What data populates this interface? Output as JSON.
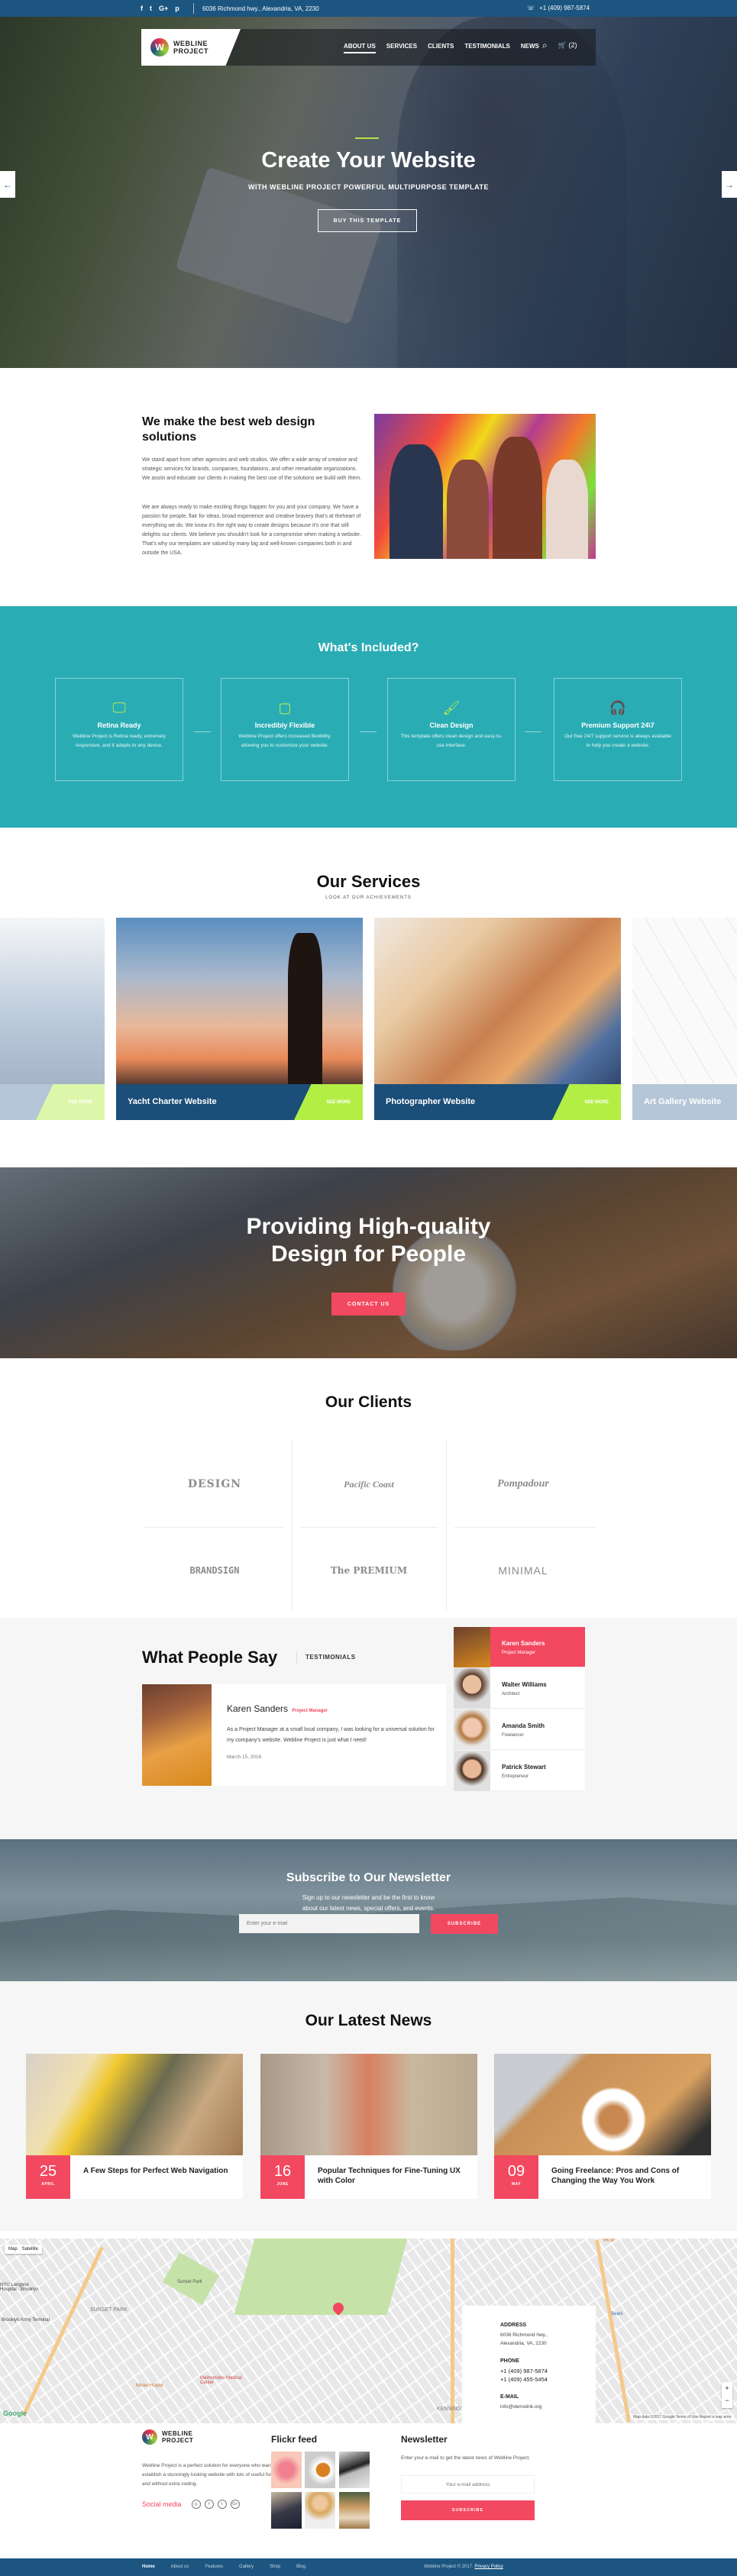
{
  "topbar": {
    "social_icons": [
      "f",
      "t",
      "G+",
      "p"
    ],
    "social_names": [
      "facebook-icon",
      "twitter-icon",
      "google-plus-icon",
      "pinterest-icon"
    ],
    "address": "6036 Richmond hwy., Alexandria, VA, 2230",
    "phone_icon": "☏",
    "phone": "+1 (409) 987-5874"
  },
  "brand": {
    "line1": "WEBLINE",
    "line2": "PROJECT",
    "mark": "W"
  },
  "nav": {
    "items": [
      "ABOUT US",
      "SERVICES",
      "CLIENTS",
      "TESTIMONIALS",
      "NEWS"
    ],
    "active_index": 0,
    "search_icon": "⌕",
    "cart_icon": "🛒",
    "cart_count": "(2)"
  },
  "hero": {
    "title": "Create Your Website",
    "subtitle": "WITH WEBLINE PROJECT POWERFUL MULTIPURPOSE TEMPLATE",
    "button": "BUY THIS TEMPLATE",
    "prev_icon": "←",
    "next_icon": "→"
  },
  "about": {
    "title": "We make the best web design solutions",
    "p1": "We stand apart from other agencies and web studios. We offer a wide array of creative and strategic services for brands, companies, foundations, and other remarkable organizations. We assist and educate our clients in making the best use of the solutions we build with them.",
    "p2": "We are always ready to make exciting things happen for you and your company. We have a passion for people, flair for ideas, broad experience and creative bravery that's at theheart of everything we do. We know it's the right way to create designs because it's one that still delights our clients. We believe you shouldn't look for a compromise when making a website. That's why our templates are valued by many big and well-known companies both in and outside the USA."
  },
  "included": {
    "title": "What's Included?",
    "features": [
      {
        "icon": "🖵",
        "title": "Retina Ready",
        "desc": "Webline Project is Retina ready, extremely responsive, and it adapts to any device."
      },
      {
        "icon": "▢",
        "title": "Incredibly Flexible",
        "desc": "Webline Project offers increased flexibility, allowing you to customize your website."
      },
      {
        "icon": "🖌",
        "title": "Clean Design",
        "desc": "This template offers clean design and easy-to-use interface."
      },
      {
        "icon": "🎧",
        "title": "Premium Support 24\\7",
        "desc": "Our free 24/7 support service is always available to help you create a website."
      }
    ]
  },
  "services": {
    "title": "Our Services",
    "subtitle": "LOOK AT OUR ACHIEVEMENTS",
    "see_more": "SEE MORE",
    "items": [
      "",
      "Yacht Charter Website",
      "Photographer Website",
      "Art Gallery Website"
    ]
  },
  "cta": {
    "title_line1": "Providing High-quality",
    "title_line2": "Design for People",
    "button": "CONTACT US"
  },
  "clients": {
    "title": "Our Clients",
    "logos": [
      "DESIGN",
      "Pacific Coast",
      "Pompadour",
      "BRANDSIGN",
      "The PREMIUM",
      "MINIMAL"
    ]
  },
  "testimonials": {
    "title": "What People Say",
    "tab": "TESTIMONIALS",
    "featured": {
      "name": "Karen Sanders",
      "role": "Project Manager",
      "quote": "As a Project Manager at a small local company, I was looking for a universal solution for my company's website. Webline Project is just what I need!",
      "date": "March 15, 2016"
    },
    "people": [
      {
        "name": "Karen Sanders",
        "role": "Project Manager"
      },
      {
        "name": "Walter Williams",
        "role": "Architect"
      },
      {
        "name": "Amanda Smith",
        "role": "Freelancer"
      },
      {
        "name": "Patrick Stewart",
        "role": "Entrepreneur"
      }
    ],
    "active_index": 0
  },
  "newsletter": {
    "title": "Subscribe to Our Newsletter",
    "text_line1": "Sign up to our newsletter and be the first to know",
    "text_line2": "about our latest news, special offers, and events.",
    "placeholder": "Enter your e-mail",
    "button": "SUBSCRIBE"
  },
  "news": {
    "title": "Our Latest News",
    "items": [
      {
        "day": "25",
        "month": "APRIL",
        "title": "A Few Steps for Perfect Web Navigation"
      },
      {
        "day": "16",
        "month": "JUNE",
        "title": "Popular Techniques for Fine-Tuning UX with Color"
      },
      {
        "day": "09",
        "month": "MAY",
        "title": "Going Freelance: Pros and Cons of Changing the Way You Work"
      }
    ]
  },
  "map": {
    "type_map": "Map",
    "type_satellite": "Satellite",
    "labels": [
      "SUNSET PARK",
      "Sunset Park",
      "KENSINGTON",
      "Maimonides Medical Center",
      "Mister Hotpot",
      "NYU Langone Hospital - Brooklyn",
      "Brooklyn Army Terminal",
      "Sears",
      "IHOP"
    ],
    "google": "Google",
    "attribution": "Map data ©2017 Google  Terms of Use  Report a map error",
    "address_label": "ADDRESS",
    "address_line1": "6036 Richmond hwy.,",
    "address_line2": "Alexandria, VA, 2230",
    "phone_label": "PHONE",
    "phone1": "+1 (409) 987-5874",
    "phone2": "+1 (409) 455-5454",
    "email_label": "E-MAIL",
    "email": "info@demolink.org",
    "zoom_in": "+",
    "zoom_out": "−"
  },
  "footer": {
    "about": "Webline Project is a perfect solution for everyone who wants to establish a stunningly looking website with lots of useful functions and without extra coding.",
    "social_label": "Social media",
    "social_icons": [
      "◎",
      "f",
      "t",
      "G+"
    ],
    "flickr_title": "Flickr feed",
    "newsletter_title": "Newsletter",
    "newsletter_text": "Enter your e-mail to get the latest news of Webline Project.",
    "newsletter_placeholder": "Your e-mail address",
    "newsletter_button": "SUBSCRIBE"
  },
  "bottom": {
    "links": [
      "Home",
      "About us",
      "Features",
      "Gallery",
      "Shop",
      "Blog"
    ],
    "active_index": 0,
    "copyright": "Webline Project © 2017.",
    "privacy": "Privacy Policy"
  }
}
